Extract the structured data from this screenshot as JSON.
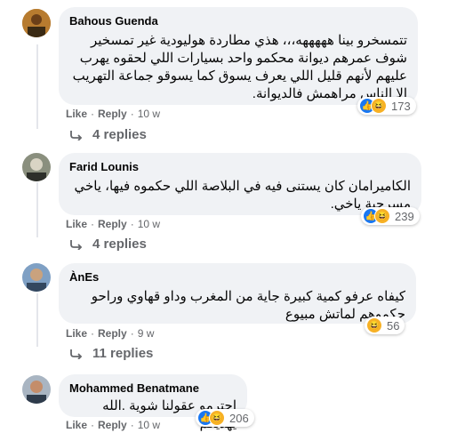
{
  "comments": [
    {
      "author": "Bahous Guenda",
      "text": "تتمسخرو بينا هههههه،،، هذي مطاردة هوليودية غير تمسخير\nشوف عمرهم ديوانة محكمو واحد بسيارات اللي لحقوه يهرب\nعليهم لأنهم قليل اللي يعرف يسوق كما يسوقو جماعة التهريب\nإلا الناس مراهمش فالديوانة.",
      "reactions": "173",
      "like": "Like",
      "reply": "Reply",
      "time": "10 w",
      "replies": "4 replies"
    },
    {
      "author": "Farid Lounis",
      "text": "الكاميرامان كان يستنى فيه في البلاصة اللي حكموه فيها، ياخي\nمسرحية ياخي.",
      "reactions": "239",
      "like": "Like",
      "reply": "Reply",
      "time": "10 w",
      "replies": "4 replies"
    },
    {
      "author": "ÀnEs",
      "text": "كيفاه عرفو كمية كبيرة جاية من المغرب وداو قهاوي وراحو\nحكموهم لماتش مبيوع",
      "reactions": "56",
      "like": "Like",
      "reply": "Reply",
      "time": "9 w",
      "replies": "11 replies"
    },
    {
      "author": "Mohammed Benatmane",
      "text": "احترمو عقولنا شوية .الله يهديكم",
      "reactions": "206",
      "like": "Like",
      "reply": "Reply",
      "time": "10 w",
      "replies": ""
    }
  ],
  "icons": {
    "like": "thumbs-up-icon",
    "haha": "haha-icon",
    "reply": "reply-arrow-icon"
  },
  "colors": {
    "bubble": "#f0f2f5",
    "secondary_text": "#65676b",
    "like_blue": "#1877f2",
    "haha_yellow": "#f7b125"
  }
}
